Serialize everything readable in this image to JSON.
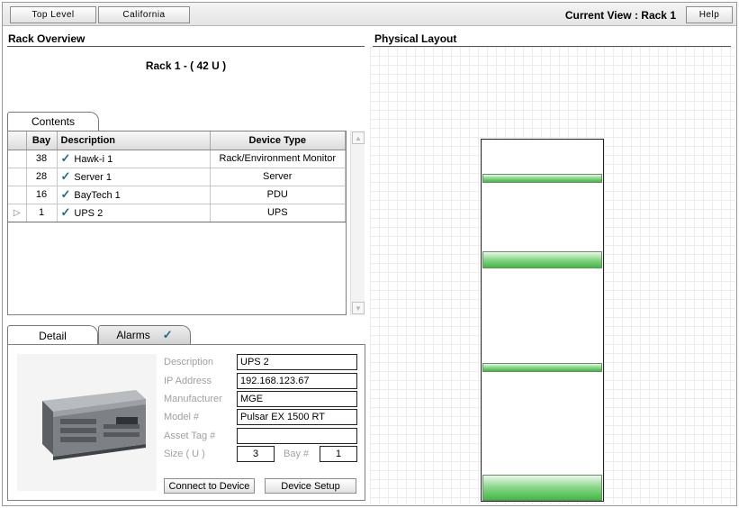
{
  "toolbar": {
    "breadcrumb": [
      "Top Level",
      "California"
    ],
    "current_view": "Current View : Rack 1",
    "help_label": "Help"
  },
  "rack_overview": {
    "title": "Rack Overview",
    "rack_heading": "Rack 1 - ( 42 U )"
  },
  "contents": {
    "tab_label": "Contents",
    "columns": [
      "Bay",
      "Description",
      "Device Type"
    ],
    "rows": [
      {
        "bay": "38",
        "description": "Hawk-i 1",
        "device_type": "Rack/Environment Monitor",
        "checked": true,
        "selected": false
      },
      {
        "bay": "28",
        "description": "Server 1",
        "device_type": "Server",
        "checked": true,
        "selected": false
      },
      {
        "bay": "16",
        "description": "BayTech 1",
        "device_type": "PDU",
        "checked": true,
        "selected": false
      },
      {
        "bay": "1",
        "description": "UPS 2",
        "device_type": "UPS",
        "checked": true,
        "selected": true
      }
    ]
  },
  "detail": {
    "tab_detail": "Detail",
    "tab_alarms": "Alarms",
    "labels": {
      "description": "Description",
      "ip_address": "IP Address",
      "manufacturer": "Manufacturer",
      "model": "Model #",
      "asset_tag": "Asset Tag #",
      "size": "Size ( U )",
      "bay": "Bay #"
    },
    "values": {
      "description": "UPS 2",
      "ip_address": "192.168.123.67",
      "manufacturer": "MGE",
      "model": "Pulsar EX 1500 RT",
      "asset_tag": "",
      "size": "3",
      "bay": "1"
    },
    "buttons": {
      "connect": "Connect to Device",
      "setup": "Device Setup"
    }
  },
  "physical_layout": {
    "title": "Physical Layout",
    "rack_units": 42,
    "devices": [
      {
        "name": "Hawk-i 1",
        "bay": 38,
        "size_u": 1
      },
      {
        "name": "Server 1",
        "bay": 28,
        "size_u": 2
      },
      {
        "name": "BayTech 1",
        "bay": 16,
        "size_u": 1
      },
      {
        "name": "UPS 2",
        "bay": 1,
        "size_u": 3
      }
    ]
  },
  "colors": {
    "check": "#1d6a8e",
    "rack_device": "#3fba3f"
  },
  "icons": {
    "check": "check-icon",
    "row_selector": "row-selector-icon",
    "scroll_up": "scroll-up-icon",
    "scroll_down": "scroll-down-icon"
  }
}
